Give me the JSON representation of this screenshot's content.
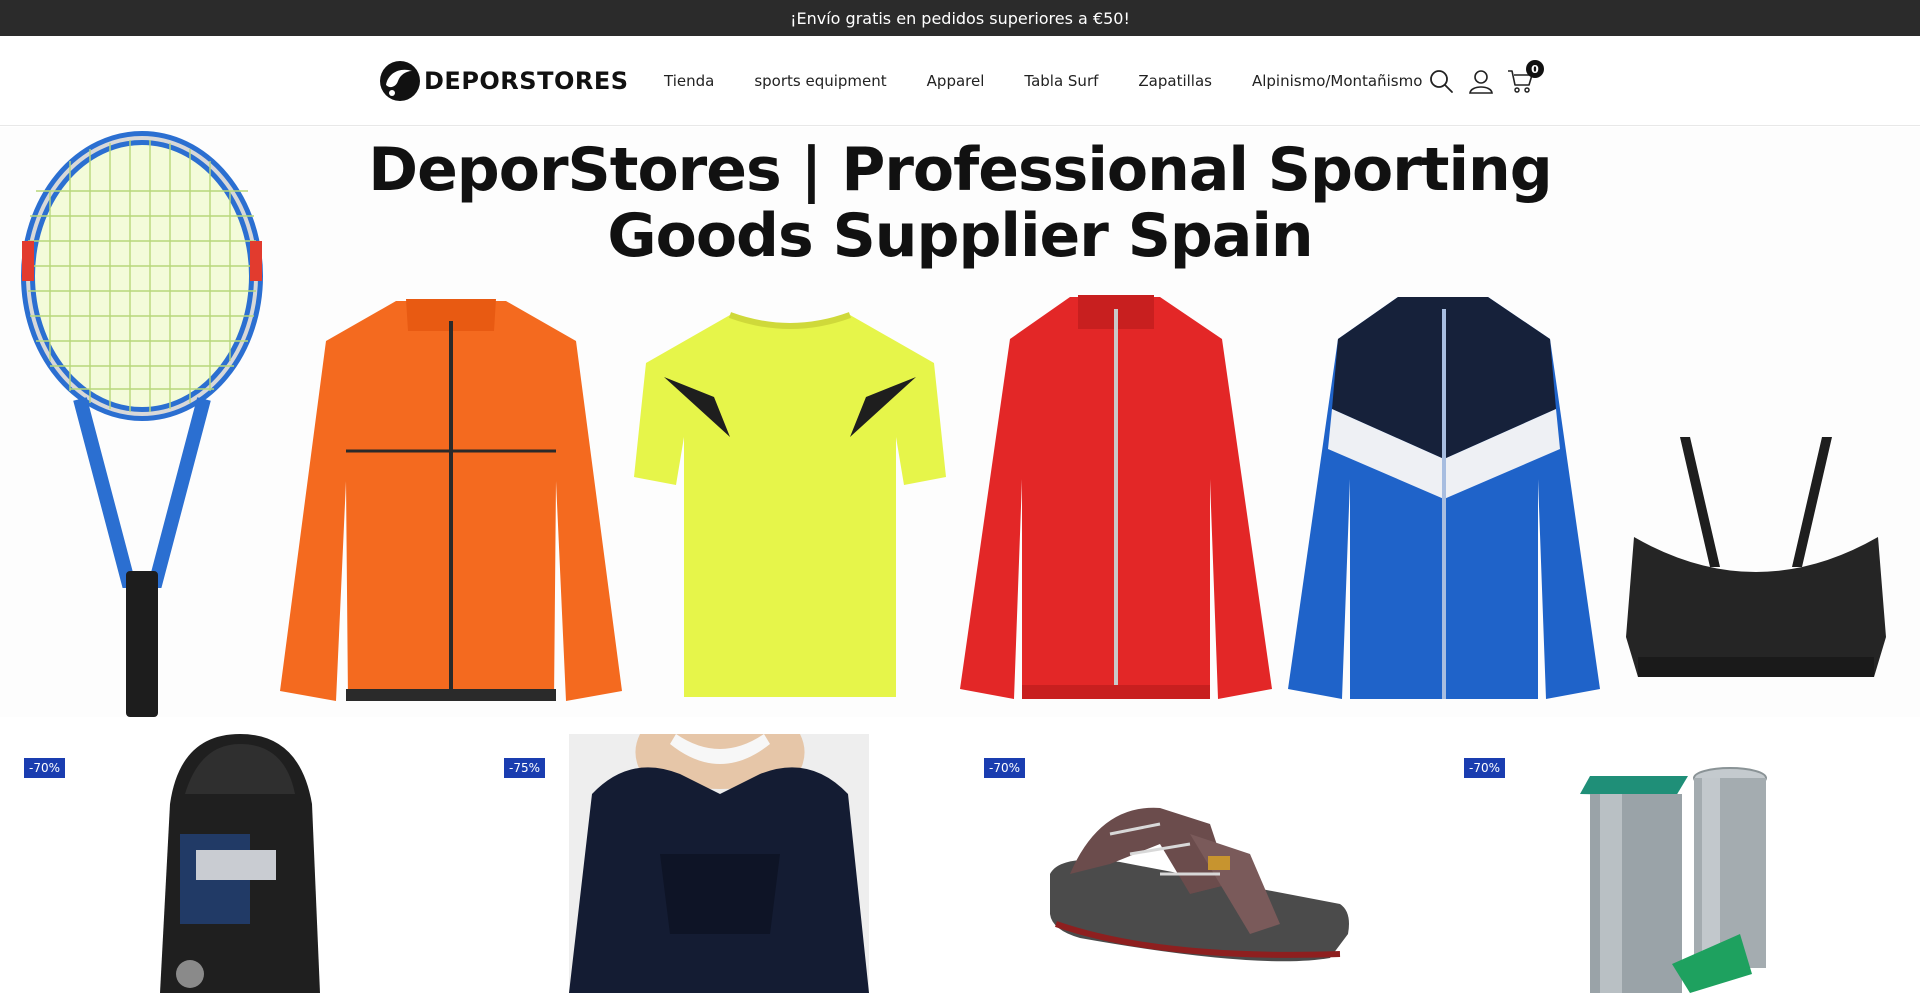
{
  "announcement": {
    "text": "¡Envío gratis en pedidos superiores a €50!"
  },
  "header": {
    "logo_text": "DEPORSTORES",
    "nav": [
      {
        "label": "Tienda"
      },
      {
        "label": "sports equipment"
      },
      {
        "label": "Apparel"
      },
      {
        "label": "Tabla Surf"
      },
      {
        "label": "Zapatillas"
      },
      {
        "label": "Alpinismo/Montañismo"
      }
    ],
    "icons": [
      "search-icon",
      "account-icon",
      "cart-icon"
    ],
    "cart_count": "0"
  },
  "hero": {
    "title_line1": "DeporStores | Professional Sporting",
    "title_line2": "Goods Supplier Spain",
    "items": [
      "tennis-racket",
      "orange-jacket",
      "yellow-tshirt",
      "red-track-jacket",
      "blue-track-jacket",
      "black-sports-bra"
    ]
  },
  "products": [
    {
      "badge": "-70%",
      "image": "backpack"
    },
    {
      "badge": "-75%",
      "image": "navy-winter-jacket"
    },
    {
      "badge": "-70%",
      "image": "sport-sandal"
    },
    {
      "badge": "-70%",
      "image": "metal-post-sleeves"
    }
  ],
  "colors": {
    "announcement_bg": "#2b2b2b",
    "badge_bg": "#1a3db0",
    "text": "#222222"
  }
}
